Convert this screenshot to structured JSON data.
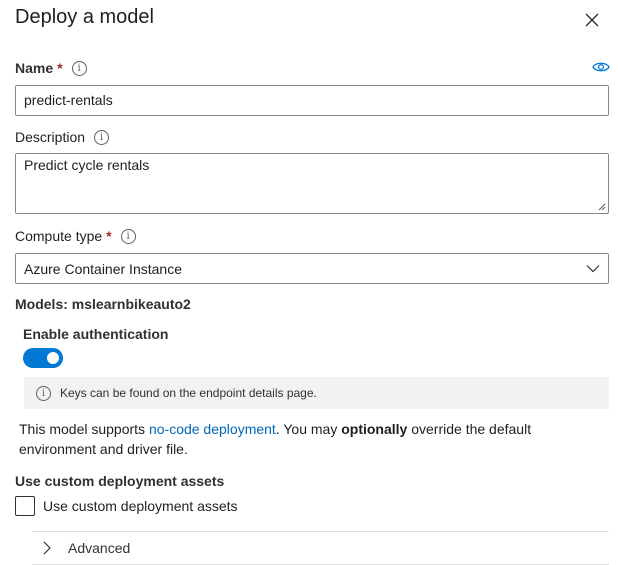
{
  "dialog": {
    "title": "Deploy a model"
  },
  "name_field": {
    "label": "Name",
    "required_mark": "*",
    "value": "predict-rentals"
  },
  "description_field": {
    "label": "Description",
    "value": "Predict cycle rentals"
  },
  "compute_type": {
    "label": "Compute type",
    "required_mark": "*",
    "selected": "Azure Container Instance"
  },
  "models_text": "Models: mslearnbikeauto2",
  "auth": {
    "label": "Enable authentication",
    "enabled": true,
    "info": "Keys can be found on the endpoint details page."
  },
  "note": {
    "prefix": "This model supports ",
    "link": "no-code deployment",
    "middle": ". You may ",
    "bold": "optionally",
    "suffix": " override the default environment and driver file."
  },
  "custom_assets": {
    "heading": "Use custom deployment assets",
    "checkbox_label": "Use custom deployment assets",
    "checked": false
  },
  "advanced": {
    "label": "Advanced"
  },
  "colors": {
    "accent": "#0078d4",
    "link": "#0067b8",
    "required": "#a4262c"
  },
  "icons": [
    "close-icon",
    "info-icon",
    "eye-icon",
    "chevron-down-icon",
    "chevron-right-icon"
  ]
}
